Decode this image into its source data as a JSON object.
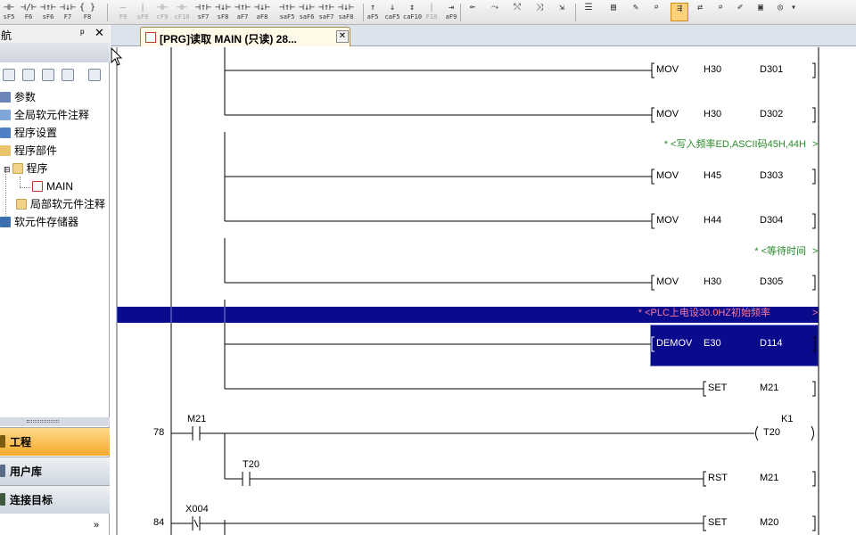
{
  "toolbar": {
    "buttons": [
      {
        "glyph": "⊣⊢",
        "sub": "sF5"
      },
      {
        "glyph": "⊣/⊢",
        "sub": "F6"
      },
      {
        "glyph": "⊣↑⊢",
        "sub": "sF6"
      },
      {
        "glyph": "⊣↓⊢",
        "sub": "F7"
      },
      {
        "glyph": "{ }",
        "sub": "F8"
      },
      {
        "glyph": "—",
        "sub": "F9"
      },
      {
        "glyph": "|",
        "sub": "sF9"
      },
      {
        "glyph": "⊣⊢",
        "sub": "cF9"
      },
      {
        "glyph": "⊣⊢",
        "sub": "cF10"
      },
      {
        "glyph": "⊣↑⊢",
        "sub": "sF7"
      },
      {
        "glyph": "⊣↓⊢",
        "sub": "sF8"
      },
      {
        "glyph": "⊣↑⊢",
        "sub": "aF7"
      },
      {
        "glyph": "⊣↓⊢",
        "sub": "aF8"
      },
      {
        "glyph": "⊣↑⊢",
        "sub": "saF5"
      },
      {
        "glyph": "⊣↓⊢",
        "sub": "saF6"
      },
      {
        "glyph": "⊣↑⊢",
        "sub": "saF7"
      },
      {
        "glyph": "⊣↓⊢",
        "sub": "saF8"
      },
      {
        "glyph": "↑",
        "sub": "aF5"
      },
      {
        "glyph": "↓",
        "sub": "caF5"
      },
      {
        "glyph": "↕",
        "sub": "caF10"
      },
      {
        "glyph": "|",
        "sub": "F10"
      },
      {
        "glyph": "⇥",
        "sub": "aF9"
      }
    ]
  },
  "nav": {
    "title": "航",
    "pin": "ᵖ",
    "close": "✕",
    "tree": [
      {
        "label": "参数"
      },
      {
        "label": "全局软元件注释"
      },
      {
        "label": "程序设置"
      },
      {
        "label": "程序部件"
      },
      {
        "label": "程序"
      },
      {
        "label": "MAIN"
      },
      {
        "label": "局部软元件注释"
      },
      {
        "label": "软元件存储器"
      }
    ],
    "sections": {
      "project": "工程",
      "library": "用户库",
      "connection": "连接目标"
    },
    "more": "»"
  },
  "tab": {
    "label": "[PRG]读取 MAIN (只读) 28...",
    "close": "✕"
  },
  "ladder": {
    "rows": [
      {
        "kind": "mov",
        "op": "MOV",
        "a": "H30",
        "b": "D301"
      },
      {
        "kind": "mov",
        "op": "MOV",
        "a": "H30",
        "b": "D302"
      },
      {
        "kind": "comment",
        "text": "* <写入频率ED,ASCII码45H,44H",
        "end": ">"
      },
      {
        "kind": "mov",
        "op": "MOV",
        "a": "H45",
        "b": "D303"
      },
      {
        "kind": "mov",
        "op": "MOV",
        "a": "H44",
        "b": "D304"
      },
      {
        "kind": "comment",
        "text": "* <等待时间",
        "end": ">"
      },
      {
        "kind": "mov",
        "op": "MOV",
        "a": "H30",
        "b": "D305"
      },
      {
        "kind": "comment-hl",
        "text": "* <PLC上电设30.0HZ初始频率",
        "end": ">"
      },
      {
        "kind": "mov-sel",
        "op": "DEMOV",
        "a": "E30",
        "b": "D114"
      },
      {
        "kind": "set",
        "op": "SET",
        "b": "M21"
      },
      {
        "kind": "timer",
        "step": "78",
        "contact": "M21",
        "coil": "T20",
        "k": "K1"
      },
      {
        "kind": "rst",
        "contact": "T20",
        "op": "RST",
        "b": "M21"
      },
      {
        "kind": "set2",
        "step": "84",
        "contact": "X004",
        "op": "SET",
        "b": "M20"
      }
    ]
  },
  "colors": {
    "highlight": "#0a0a8c",
    "comment": "#2a8a2a",
    "hl_comment": "#ff7b9c",
    "project_section": "#f6a92b"
  }
}
